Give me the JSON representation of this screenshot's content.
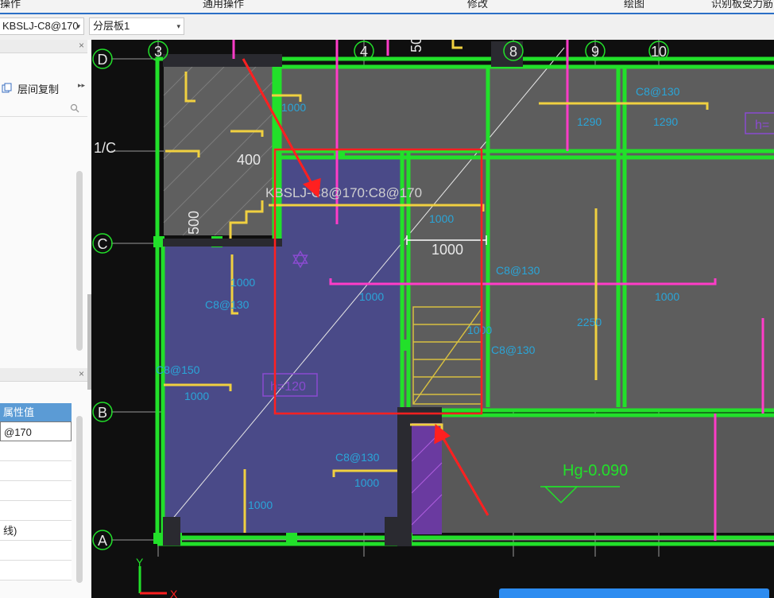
{
  "ribbon": {
    "items": [
      "操作",
      "通用操作",
      "修改",
      "绘图",
      "识别板受力筋"
    ]
  },
  "toolbar": {
    "rebar_select": "KBSLJ-C8@170",
    "layer_select": "分层板1"
  },
  "left_panel": {
    "copy_button": "层间复制",
    "props_header": "属性值",
    "props": [
      "@170",
      "",
      "",
      "",
      "",
      "线)",
      "",
      ""
    ]
  },
  "canvas": {
    "axis_top": [
      "3",
      "4",
      "8",
      "9",
      "10"
    ],
    "axis_left": [
      "D",
      "1/C",
      "C",
      "B",
      "A"
    ],
    "dims": {
      "d400": "400",
      "d500": "500",
      "d500b": "500",
      "d1000": "1000"
    },
    "rebar_label": "KBSLJ-C8@170:C8@170",
    "slab_h1": "h=120",
    "slab_h2": "h=",
    "elevation": "Hg-0.090",
    "rebar_texts": [
      "C8@130",
      "1290",
      "1290",
      "C8@130",
      "C8@130",
      "C8@130",
      "1000",
      "1000",
      "1000",
      "1000",
      "1000",
      "1000",
      "C8@150",
      "1000",
      "C8@130",
      "1000",
      "2250",
      "1000"
    ],
    "ucs_y": "Y",
    "ucs_x": "X"
  },
  "colors": {
    "canvas_bg": "#0f0f0f",
    "slab_gray": "#5d5d5d",
    "slab_blue": "#4a4a88",
    "beam_green": "#22e02a",
    "rebar_yellow": "#f0d040",
    "rebar_magenta": "#ff3cc8",
    "red_select": "#ff2020",
    "axis_gray": "#9a9a9a"
  }
}
